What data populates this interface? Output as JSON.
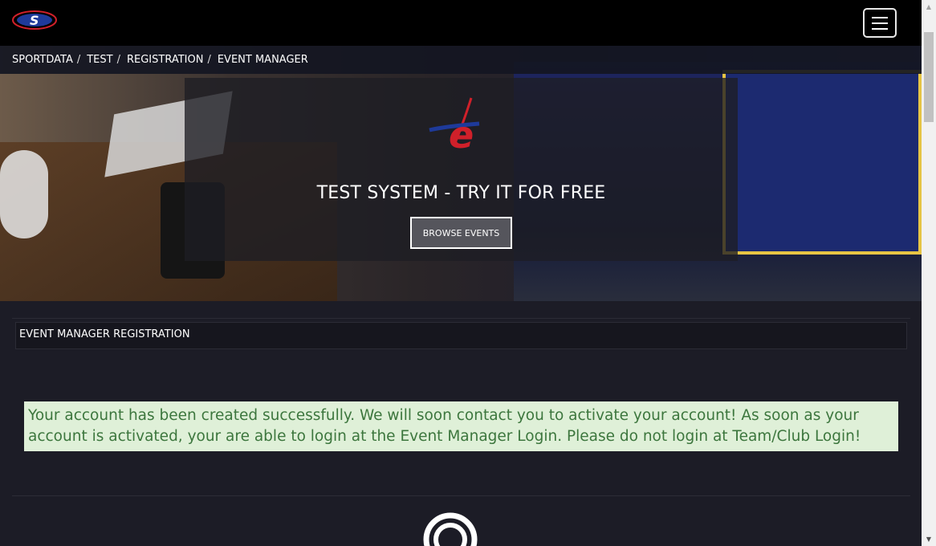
{
  "header": {
    "logo_name": "sportdata-logo",
    "menu_icon": "hamburger-menu-icon"
  },
  "breadcrumb": {
    "items": [
      "SPORTDATA",
      "TEST",
      "REGISTRATION",
      "EVENT MANAGER"
    ],
    "separator": "/"
  },
  "hero": {
    "title": "TEST SYSTEM - TRY IT FOR FREE",
    "button_label": "BROWSE EVENTS",
    "logo_name": "sportdata-event-logo"
  },
  "panel": {
    "title": "EVENT MANAGER REGISTRATION"
  },
  "alert": {
    "message": "Your account has been created successfully. We will soon contact you to activate your account! As soon as your account is activated, your are able to login at the Event Manager Login. Please do not login at Team/Club Login!"
  },
  "colors": {
    "page_bg": "#1c1c26",
    "topbar_bg": "#000000",
    "alert_bg": "#dff0d8",
    "alert_text": "#3c763d",
    "brand_red": "#d0202a",
    "brand_blue": "#1e3a9a"
  }
}
